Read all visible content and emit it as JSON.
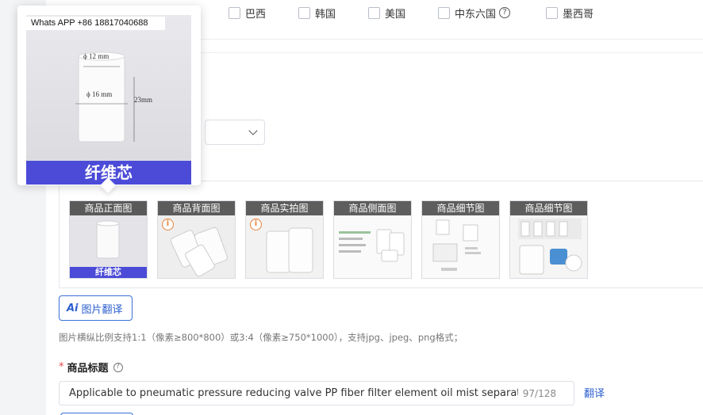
{
  "countries": [
    {
      "label": "巴西"
    },
    {
      "label": "韩国"
    },
    {
      "label": "美国"
    },
    {
      "label": "中东六国"
    },
    {
      "label": "墨西哥"
    }
  ],
  "popover": {
    "watermark": "Whats APP +86 18817040688",
    "dim_top": "12 mm",
    "dim_middle": "16 mm",
    "dim_height": "23mm",
    "bottom_label": "纤维芯"
  },
  "images": [
    {
      "caption": "商品正面图",
      "bottom_label": "纤维芯",
      "warning": false
    },
    {
      "caption": "商品背面图",
      "warning": true
    },
    {
      "caption": "商品实拍图",
      "warning": true
    },
    {
      "caption": "商品侧面图",
      "warning": false
    },
    {
      "caption": "商品细节图",
      "warning": false
    },
    {
      "caption": "商品细节图",
      "warning": false
    }
  ],
  "ai_translate_button": {
    "icon_text": "Ai",
    "label": "图片翻译"
  },
  "image_hint": "图片横纵比例支持1:1（像素≥800*800）或3:4（像素≥750*1000），支持jpg、jpeg、png格式；",
  "title_field": {
    "required_mark": "*",
    "label": "商品标题",
    "value": "Applicable to pneumatic pressure reducing valve PP fiber filter element oil mist separator va",
    "count": "97/128",
    "translate_link": "翻译"
  },
  "colors": {
    "primary": "#2c5fcf",
    "purple_band": "#4b4bd8",
    "warning": "#e8833a",
    "required": "#e64545"
  },
  "icons": {
    "help": "question-circle-icon",
    "select": "chevron-down-icon",
    "warning": "info-circle-icon"
  }
}
